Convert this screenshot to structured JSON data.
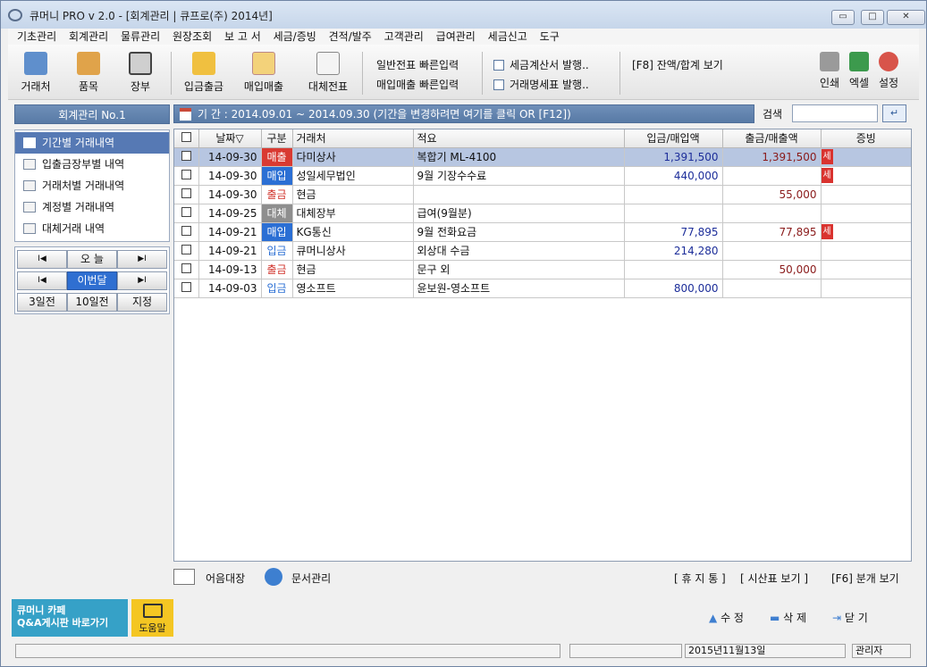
{
  "window": {
    "title": "큐머니 PRO v 2.0 - [회계관리 | 큐프로(주) 2014년]",
    "min": "▭",
    "max": "□",
    "close": "✕"
  },
  "menu": [
    "기초관리",
    "회계관리",
    "물류관리",
    "원장조회",
    "보 고 서",
    "세금/증빙",
    "견적/발주",
    "고객관리",
    "급여관리",
    "세금신고",
    "도구"
  ],
  "toolbar": {
    "customer": "거래처",
    "item": "품목",
    "ledger": "장부",
    "deposit": "입금출금",
    "purchase_sales": "매입매출",
    "transfer": "대체전표",
    "quick1": "일반전표 빠른입력",
    "quick2": "매입매출 빠른입력",
    "tax_invoice": "세금계산서 발행..",
    "statement": "거래명세표 발행..",
    "balance": "[F8] 잔액/합계 보기",
    "print": "인쇄",
    "excel": "엑셀",
    "settings": "설정"
  },
  "left": {
    "header": "회계관리 No.1",
    "nav": [
      "기간별 거래내역",
      "입출금장부별 내역",
      "거래처별 거래내역",
      "계정별 거래내역",
      "대체거래 내역"
    ],
    "today": "오 늘",
    "this_month": "이번달",
    "d3": "3일전",
    "d10": "10일전",
    "custom": "지정",
    "prev": "I◀",
    "next": "▶I"
  },
  "period": {
    "text": "기 간 : 2014.09.01 ~ 2014.09.30 (기간을 변경하려면 여기를 클릭 OR [F12])"
  },
  "search": {
    "label": "검색",
    "button": "↵"
  },
  "table": {
    "headers": [
      "날짜▽",
      "구분",
      "거래처",
      "적요",
      "입금/매입액",
      "출금/매출액",
      "증빙"
    ],
    "rows": [
      {
        "date": "14-09-30",
        "type": "매출",
        "party": "다미상사",
        "memo": "복합기 ML-4100",
        "in": "1,391,500",
        "out": "1,391,500",
        "evid": "세",
        "tcolor": "#d93a32",
        "ttext": "#ffffff"
      },
      {
        "date": "14-09-30",
        "type": "매입",
        "party": "성일세무법인",
        "memo": "9월 기장수수료",
        "in": "440,000",
        "out": "",
        "evid": "세",
        "tcolor": "#2b6fd4",
        "ttext": "#ffffff"
      },
      {
        "date": "14-09-30",
        "type": "출금",
        "party": "현금",
        "memo": "",
        "in": "",
        "out": "55,000",
        "evid": "",
        "tcolor": "#ffffff",
        "ttext": "#d0332b"
      },
      {
        "date": "14-09-25",
        "type": "대체",
        "party": "대체장부",
        "memo": "급여(9월분)",
        "in": "",
        "out": "",
        "evid": "",
        "tcolor": "#8e8e8e",
        "ttext": "#ffffff"
      },
      {
        "date": "14-09-21",
        "type": "매입",
        "party": "KG통신",
        "memo": "9월 전화요금",
        "in": "77,895",
        "out": "77,895",
        "evid": "세",
        "tcolor": "#2b6fd4",
        "ttext": "#ffffff"
      },
      {
        "date": "14-09-21",
        "type": "입금",
        "party": "큐머니상사",
        "memo": "외상대 수금",
        "in": "214,280",
        "out": "",
        "evid": "",
        "tcolor": "#ffffff",
        "ttext": "#2b6fd4"
      },
      {
        "date": "14-09-13",
        "type": "출금",
        "party": "현금",
        "memo": "문구 외",
        "in": "",
        "out": "50,000",
        "evid": "",
        "tcolor": "#ffffff",
        "ttext": "#d0332b"
      },
      {
        "date": "14-09-03",
        "type": "입금",
        "party": "영소프트",
        "memo": "윤보원-영소프트",
        "in": "800,000",
        "out": "",
        "evid": "",
        "tcolor": "#ffffff",
        "ttext": "#2b6fd4"
      }
    ]
  },
  "bottom": {
    "bills": "어음대장",
    "docs": "문서관리",
    "trash": "[ 휴 지 통 ]",
    "trial": "[ 시산표 보기 ]",
    "split": "[F6] 분개 보기"
  },
  "banner": {
    "line1": "큐머니 카페",
    "line2": "Q&A게시판 바로가기",
    "help": "도움말"
  },
  "actions": {
    "edit": "수 정",
    "delete": "삭 제",
    "close": "닫 기"
  },
  "status": {
    "date": "2015년11월13일",
    "user": "관리자"
  }
}
